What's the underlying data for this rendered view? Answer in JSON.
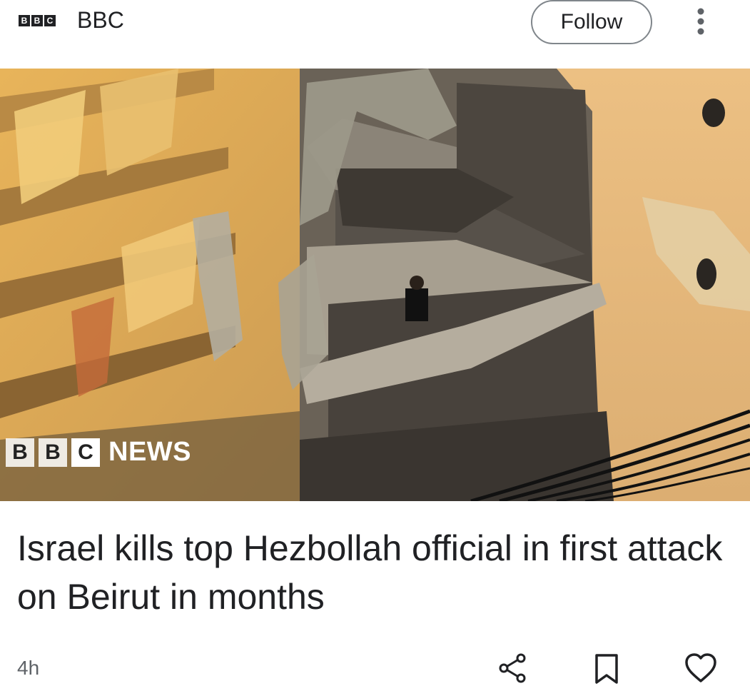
{
  "header": {
    "logo_letters": [
      "B",
      "B",
      "C"
    ],
    "source_name": "BBC",
    "follow_label": "Follow",
    "more_icon": "more-vert-icon"
  },
  "hero": {
    "watermark_letters": [
      "B",
      "B",
      "C"
    ],
    "watermark_text": "NEWS"
  },
  "article": {
    "headline": "Israel kills top Hezbollah official in first attack on Beirut in months",
    "time": "4h"
  },
  "actions": {
    "share_icon": "share-icon",
    "bookmark_icon": "bookmark-icon",
    "like_icon": "heart-icon"
  }
}
